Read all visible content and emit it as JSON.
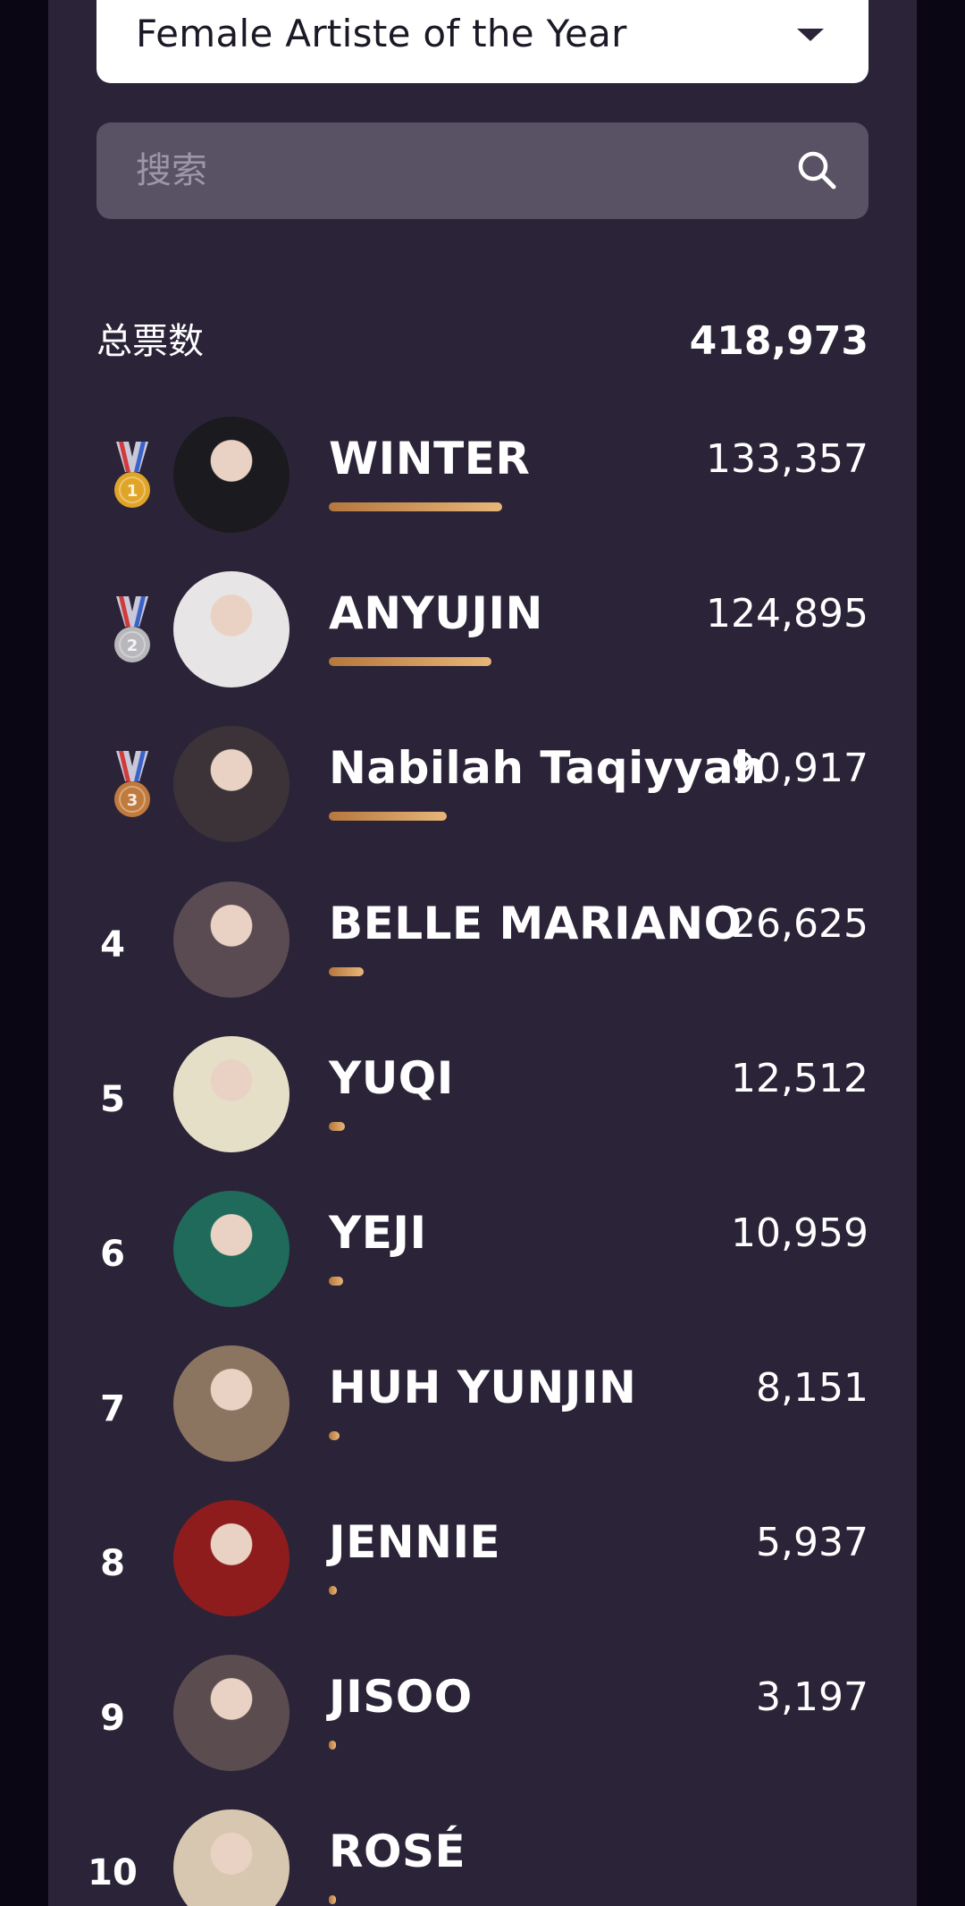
{
  "category_dropdown": {
    "selected": "Female Artiste of the Year"
  },
  "search": {
    "placeholder": "搜索"
  },
  "total": {
    "label": "总票数",
    "value": "418,973"
  },
  "max_votes": 133357,
  "colors": {
    "page_bg": "#2b2438",
    "outer_bg": "#0a0614",
    "bar_start": "#b5773d",
    "bar_end": "#e8b678",
    "gold": "#e0a528",
    "silver": "#b8b8bc",
    "bronze": "#c07a3c"
  },
  "ranking": [
    {
      "rank": "1",
      "medal": "gold",
      "medal_number": "1",
      "name": "WINTER",
      "votes": "133,357",
      "vote_count": 133357,
      "avatar_color": "#1a1a1f"
    },
    {
      "rank": "2",
      "medal": "silver",
      "medal_number": "2",
      "name": "ANYUJIN",
      "votes": "124,895",
      "vote_count": 124895,
      "avatar_color": "#e7e5e6"
    },
    {
      "rank": "3",
      "medal": "bronze",
      "medal_number": "3",
      "name": "Nabilah Taqiyyah",
      "votes": "90,917",
      "vote_count": 90917,
      "avatar_color": "#3b3338"
    },
    {
      "rank": "4",
      "medal": "",
      "medal_number": "",
      "name": "BELLE MARIANO",
      "votes": "26,625",
      "vote_count": 26625,
      "avatar_color": "#5a4a52"
    },
    {
      "rank": "5",
      "medal": "",
      "medal_number": "",
      "name": "YUQI",
      "votes": "12,512",
      "vote_count": 12512,
      "avatar_color": "#e6dfc8"
    },
    {
      "rank": "6",
      "medal": "",
      "medal_number": "",
      "name": "YEJI",
      "votes": "10,959",
      "vote_count": 10959,
      "avatar_color": "#1f6a5a"
    },
    {
      "rank": "7",
      "medal": "",
      "medal_number": "",
      "name": "HUH YUNJIN",
      "votes": "8,151",
      "vote_count": 8151,
      "avatar_color": "#8b7460"
    },
    {
      "rank": "8",
      "medal": "",
      "medal_number": "",
      "name": "JENNIE",
      "votes": "5,937",
      "vote_count": 5937,
      "avatar_color": "#8e1c1c"
    },
    {
      "rank": "9",
      "medal": "",
      "medal_number": "",
      "name": "JISOO",
      "votes": "3,197",
      "vote_count": 3197,
      "avatar_color": "#5b4c50"
    },
    {
      "rank": "10",
      "medal": "",
      "medal_number": "",
      "name": "ROSÉ",
      "votes": "",
      "vote_count": 1000,
      "avatar_color": "#d8c7b0"
    }
  ]
}
